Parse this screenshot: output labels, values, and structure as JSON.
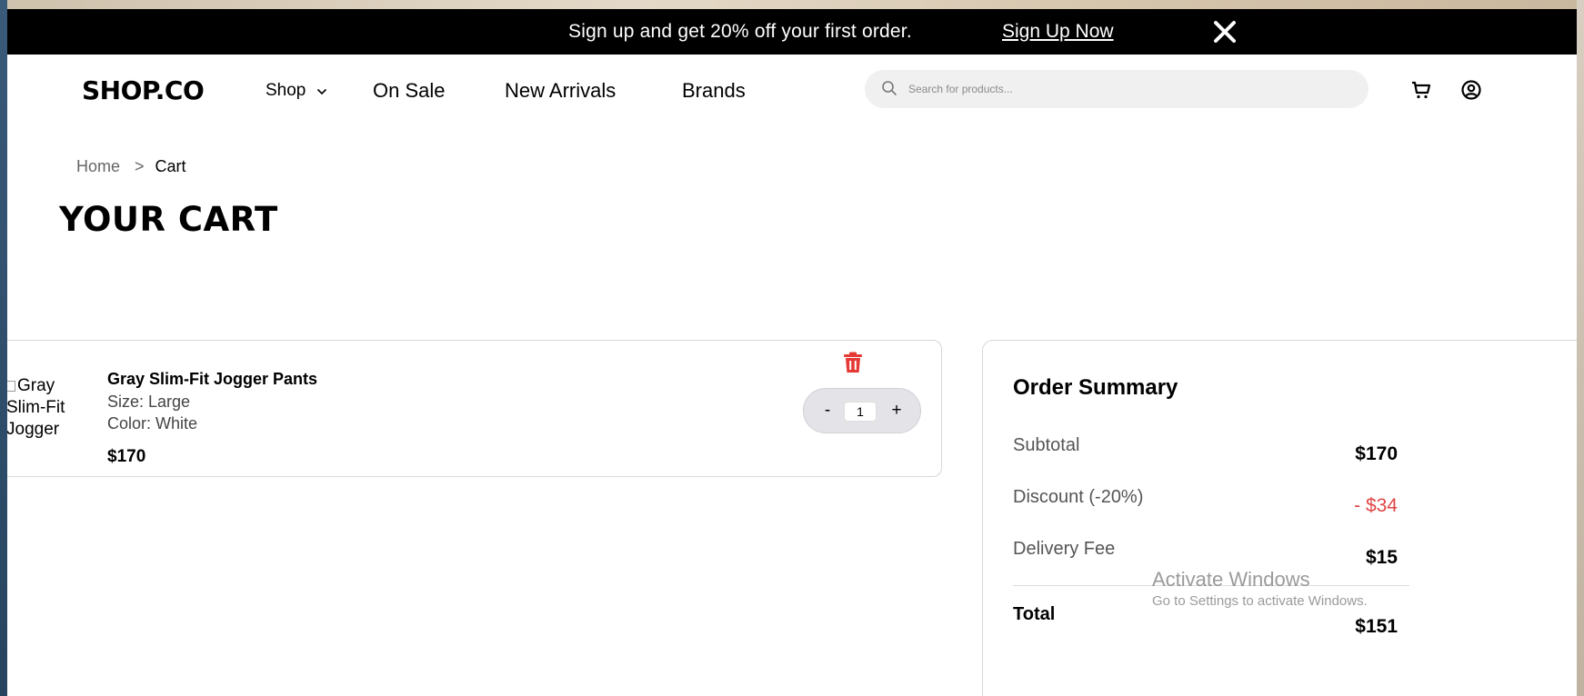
{
  "promo": {
    "text": "Sign up and get 20% off your first order.",
    "link": "Sign Up Now",
    "close_icon": "close-icon"
  },
  "nav": {
    "logo": "SHOP.CO",
    "shop": "Shop",
    "on_sale": "On Sale",
    "new_arrivals": "New Arrivals",
    "brands": "Brands",
    "search_placeholder": "Search for products...",
    "icons": [
      "search-icon",
      "cart-icon",
      "user-icon"
    ]
  },
  "breadcrumb": {
    "home": "Home",
    "separator": ">",
    "current": "Cart"
  },
  "page_title": "YOUR CART",
  "cart": {
    "items": [
      {
        "image_alt": "Gray Slim-Fit Jogger",
        "name": "Gray Slim-Fit Jogger Pants",
        "size": "Size: Large",
        "color": "Color: White",
        "price": "$170",
        "quantity": "1",
        "minus_label": "-",
        "plus_label": "+"
      }
    ]
  },
  "summary": {
    "title": "Order Summary",
    "subtotal_label": "Subtotal",
    "subtotal_value": "$170",
    "discount_label": "Discount (-20%)",
    "discount_value": "- $34",
    "delivery_label": "Delivery Fee",
    "delivery_value": "$15",
    "total_label": "Total",
    "total_value": "$151"
  },
  "watermark": {
    "title": "Activate Windows",
    "subtitle": "Go to Settings to activate Windows."
  },
  "colors": {
    "promo_bg": "#000000",
    "discount": "#e04545",
    "trash": "#e53935"
  }
}
